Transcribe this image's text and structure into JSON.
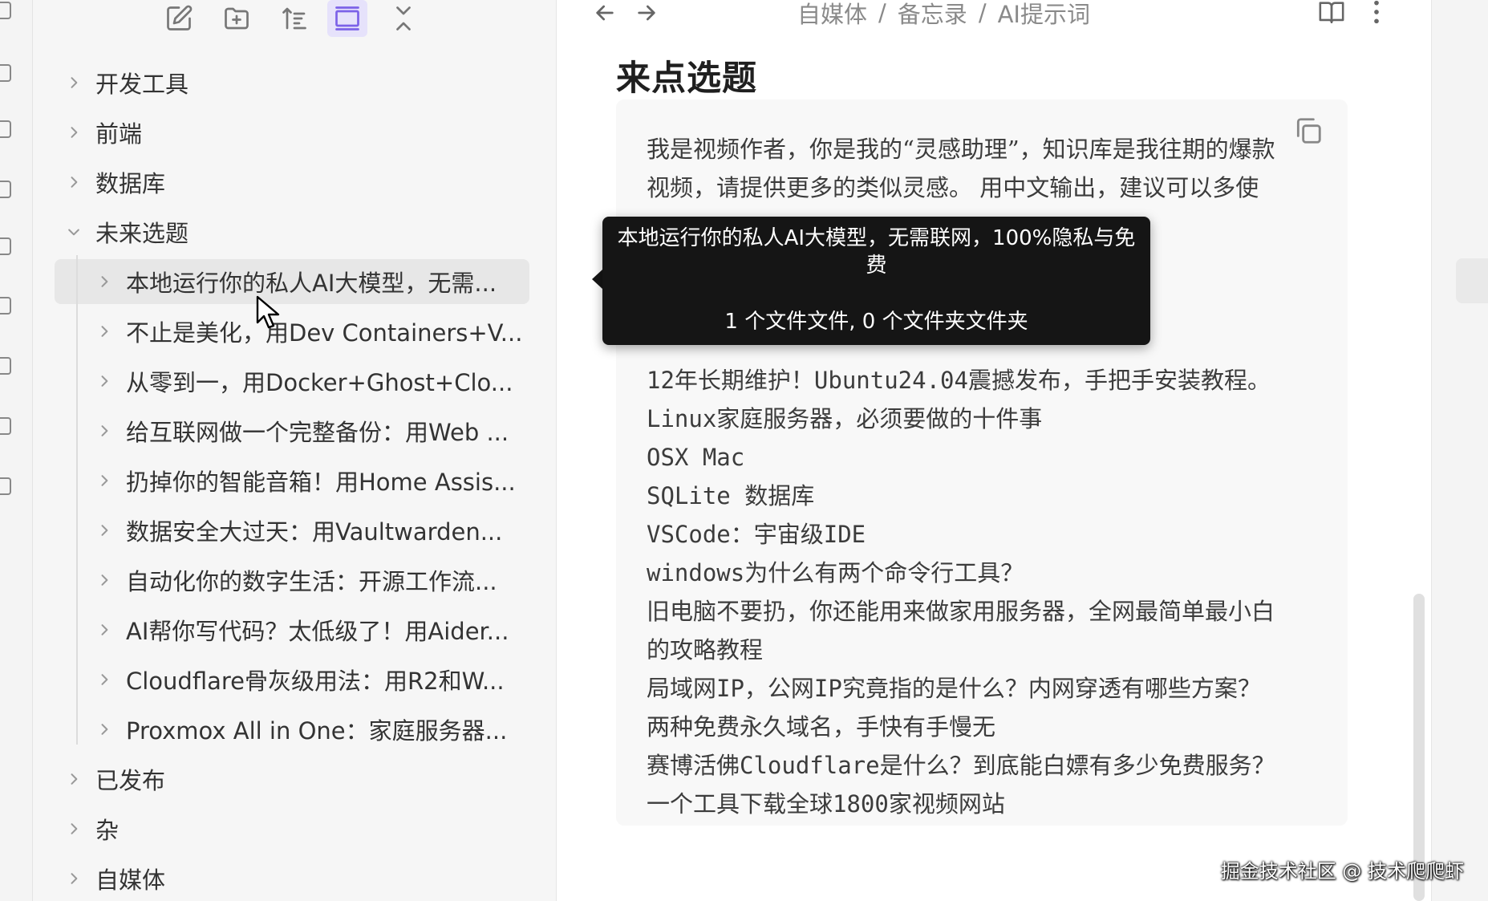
{
  "sidebar": {
    "toolbar": [
      {
        "name": "new-note-button",
        "icon": "edit-icon"
      },
      {
        "name": "new-folder-button",
        "icon": "folder-plus-icon"
      },
      {
        "name": "sort-button",
        "icon": "sort-icon"
      },
      {
        "name": "auto-reveal-button",
        "icon": "reveal-icon",
        "active": true
      },
      {
        "name": "collapse-all-button",
        "icon": "collapse-icon"
      }
    ],
    "tree": {
      "folders_top": [
        "开发工具",
        "前端",
        "数据库",
        "未来选题"
      ],
      "children": [
        "本地运行你的私人AI大模型，无需...",
        "不止是美化，用Dev Containers+V...",
        "从零到一，用Docker+Ghost+Clo...",
        "给互联网做一个完整备份：用Web ...",
        "扔掉你的智能音箱！用Home Assis...",
        "数据安全大过天：用Vaultwarden...",
        "自动化你的数字生活：开源工作流...",
        "AI帮你写代码？太低级了！用Aider...",
        "Cloudflare骨灰级用法：用R2和W...",
        "Proxmox All in One：家庭服务器..."
      ],
      "folders_bottom": [
        "已发布",
        "杂",
        "自媒体"
      ]
    }
  },
  "main": {
    "breadcrumb": [
      "自媒体",
      "备忘录",
      "AI提示词"
    ],
    "breadcrumb_sep": "/",
    "title": "来点选题",
    "code_lines": [
      "我是视频作者，你是我的“灵感助理”，知识库是我往期的爆款",
      "视频，请提供更多的类似灵感。 用中文输出，建议可以多使",
      "12年长期维护！Ubuntu24.04震撼发布，手把手安装教程。",
      "Linux家庭服务器，必须要做的十件事",
      "OSX Mac",
      "SQLite 数据库",
      "VSCode：宇宙级IDE",
      "windows为什么有两个命令行工具？",
      "旧电脑不要扔，你还能用来做家用服务器，全网最简单最小白",
      "的攻略教程",
      "局域网IP，公网IP究竟指的是什么？内网穿透有哪些方案？",
      "两种免费永久域名，手快有手慢无",
      "赛博活佛Cloudflare是什么？到底能白嫖有多少免费服务？",
      "一个工具下载全球1800家视频网站"
    ]
  },
  "tooltip": {
    "title": "本地运行你的私人AI大模型，无需联网，100%隐私与免费",
    "subtitle": "1 个文件文件, 0 个文件夹文件夹"
  },
  "watermark": "掘金技术社区 @ 技术爬爬虾"
}
